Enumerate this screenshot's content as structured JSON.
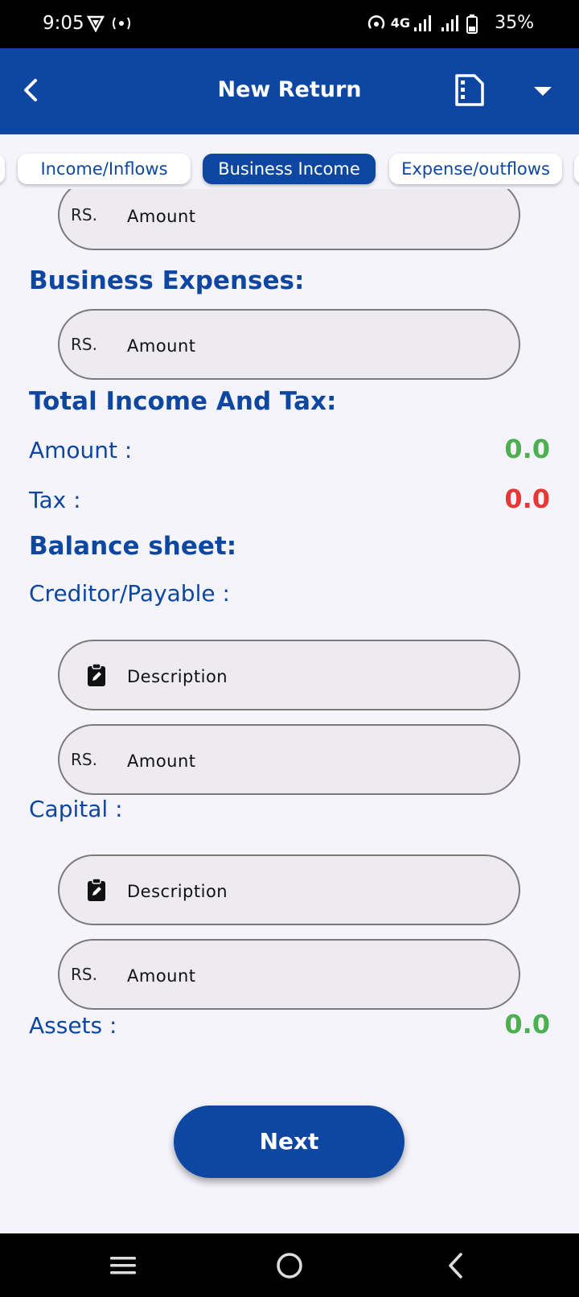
{
  "status": {
    "time": "9:05",
    "network": "4G",
    "battery": "35%"
  },
  "appbar": {
    "title": "New Return",
    "back_icon": "back-arrow-icon",
    "doc_icon": "document-icon",
    "menu_icon": "dropdown-arrow-icon"
  },
  "tabs": [
    {
      "label": "Income/Inflows",
      "active": false
    },
    {
      "label": "Business Income",
      "active": true
    },
    {
      "label": "Expense/outflows",
      "active": false
    }
  ],
  "form": {
    "top_field": {
      "prefix": "RS.",
      "value": "Amount"
    },
    "business_expenses": {
      "title": "Business Expenses:",
      "field": {
        "prefix": "RS.",
        "value": "Amount"
      }
    },
    "total": {
      "title": "Total Income And Tax:",
      "amount_label": "Amount :",
      "amount_value": "0.0",
      "tax_label": "Tax :",
      "tax_value": "0.0"
    },
    "balance": {
      "title": "Balance sheet:",
      "creditor_label": "Creditor/Payable :",
      "creditor_desc": "Description",
      "creditor_amount_prefix": "RS.",
      "creditor_amount": "Amount",
      "capital_label": "Capital :",
      "capital_desc": "Description",
      "capital_amount_prefix": "RS.",
      "capital_amount": "Amount",
      "assets_label": "Assets :",
      "assets_value": "0.0"
    }
  },
  "next_label": "Next",
  "colors": {
    "primary": "#0d47a1",
    "green": "#4caf50",
    "red": "#e53935"
  }
}
